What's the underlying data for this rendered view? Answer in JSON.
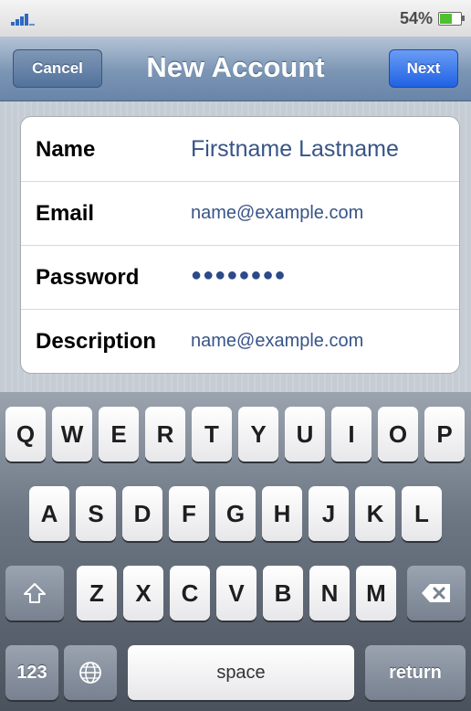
{
  "status_bar": {
    "battery_percent": "54%",
    "battery_level": 0.54
  },
  "nav": {
    "cancel_label": "Cancel",
    "title": "New Account",
    "next_label": "Next"
  },
  "form": {
    "rows": [
      {
        "label": "Name",
        "value": "Firstname Lastname"
      },
      {
        "label": "Email",
        "value": "name@example.com"
      },
      {
        "label": "Password",
        "value": "●●●●●●●●"
      },
      {
        "label": "Description",
        "value": "name@example.com"
      }
    ]
  },
  "keyboard": {
    "row1": [
      "Q",
      "W",
      "E",
      "R",
      "T",
      "Y",
      "U",
      "I",
      "O",
      "P"
    ],
    "row2": [
      "A",
      "S",
      "D",
      "F",
      "G",
      "H",
      "J",
      "K",
      "L"
    ],
    "row3": [
      "Z",
      "X",
      "C",
      "V",
      "B",
      "N",
      "M"
    ],
    "numbers_label": "123",
    "space_label": "space",
    "return_label": "return",
    "icons": {
      "shift": "shift-icon",
      "backspace": "backspace-icon",
      "globe": "globe-icon"
    }
  }
}
